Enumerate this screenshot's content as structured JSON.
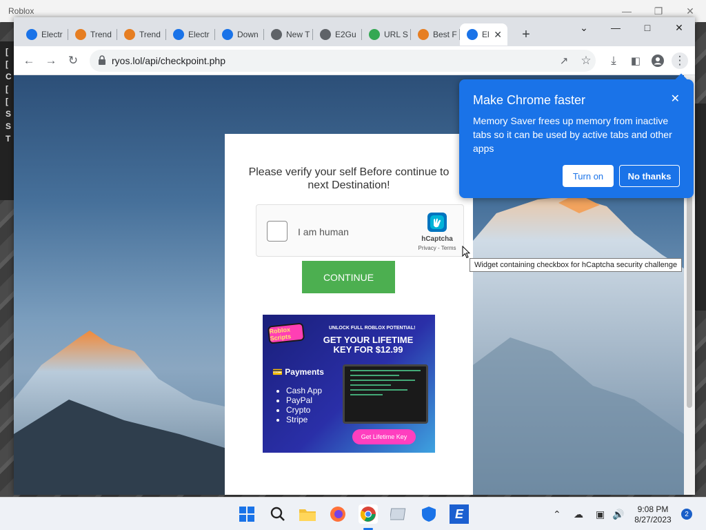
{
  "background_window": {
    "title": "Roblox",
    "side_fragments": [
      "[",
      "[",
      "C",
      "[",
      "[",
      "S",
      "S",
      "T"
    ]
  },
  "browser": {
    "tabs": [
      {
        "label": "Electr",
        "icon": "electron-icon",
        "color": "#1a73e8"
      },
      {
        "label": "Trend",
        "icon": "trend-icon",
        "color": "#e67e22"
      },
      {
        "label": "Trend",
        "icon": "trend-icon",
        "color": "#e67e22"
      },
      {
        "label": "Electr",
        "icon": "electron-icon",
        "color": "#1a73e8"
      },
      {
        "label": "Down",
        "icon": "download-icon",
        "color": "#1a73e8"
      },
      {
        "label": "New T",
        "icon": "chrome-icon",
        "color": "#5f6368"
      },
      {
        "label": "E2Gu",
        "icon": "globe-icon",
        "color": "#5f6368"
      },
      {
        "label": "URL S",
        "icon": "url-icon",
        "color": "#34a853"
      },
      {
        "label": "Best F",
        "icon": "trend-icon",
        "color": "#e67e22"
      },
      {
        "label": "El",
        "icon": "electron-icon",
        "color": "#1a73e8",
        "active": true
      }
    ],
    "url": "ryos.lol/api/checkpoint.php"
  },
  "page": {
    "verify_text": "Please verify your self Before continue to next Destination!",
    "captcha": {
      "label": "I am human",
      "brand": "hCaptcha",
      "links": "Privacy - Terms"
    },
    "continue_label": "CONTINUE",
    "ad": {
      "logo": "Roblox Scripts",
      "small": "UNLOCK FULL ROBLOX POTENTIAL!",
      "headline": "GET YOUR LIFETIME KEY FOR $12.99",
      "payments_label": "💳 Payments",
      "methods": [
        "Cash App",
        "PayPal",
        "Crypto",
        "Stripe"
      ],
      "button": "Get Lifetime Key"
    }
  },
  "popup": {
    "title": "Make Chrome faster",
    "body": "Memory Saver frees up memory from inactive tabs so it can be used by active tabs and other apps",
    "primary": "Turn on",
    "secondary": "No thanks"
  },
  "tooltip": "Widget containing checkbox for hCaptcha security challenge",
  "taskbar": {
    "time": "9:08 PM",
    "date": "8/27/2023",
    "notifications": "2"
  }
}
